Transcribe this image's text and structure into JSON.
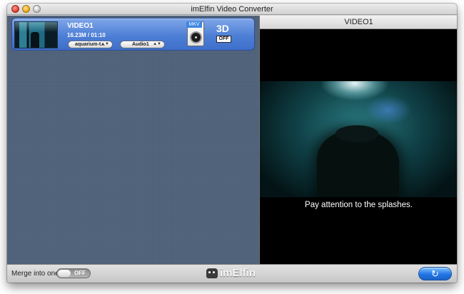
{
  "window": {
    "title": "imElfin Video Converter"
  },
  "task": {
    "name": "VIDEO1",
    "meta": "16.23M / 01:10",
    "subtitle_select": "aquarium-t...",
    "audio_select": "Audio1",
    "format_label": "MKV",
    "label_3d": "3D",
    "toggle_3d": "OFF"
  },
  "preview": {
    "title": "VIDEO1",
    "subtitle_text": "Pay attention to the splashes."
  },
  "bottom": {
    "merge_label": "Merge into one",
    "merge_toggle": "OFF",
    "brand": "imElfin"
  },
  "icons": {
    "format": "mkv-file-icon",
    "convert": "convert-arrow-icon",
    "brand": "imelfin-logo-icon"
  },
  "colors": {
    "card": "#4e7fd6",
    "pane": "#4f6179",
    "convert": "#2275e6"
  }
}
